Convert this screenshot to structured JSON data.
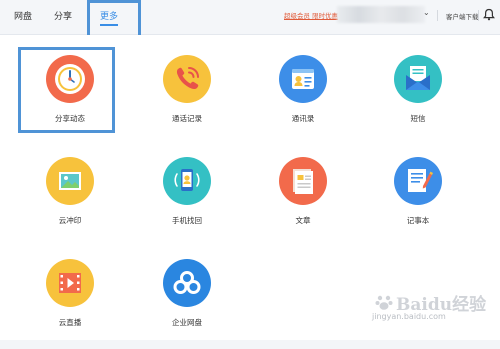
{
  "nav": {
    "tabs": [
      {
        "label": "网盘"
      },
      {
        "label": "分享"
      },
      {
        "label": "更多",
        "active": true
      }
    ]
  },
  "header": {
    "promo_link": "超级会员 限时优惠",
    "client_download": "客户端下载",
    "bell_icon": "bell-icon",
    "user_chevron": "chevron-down-icon"
  },
  "apps": [
    {
      "label": "分享动态",
      "icon": "clock-icon",
      "color": "#f26a4b"
    },
    {
      "label": "通话记录",
      "icon": "phone-icon",
      "color": "#f7c23c"
    },
    {
      "label": "通讯录",
      "icon": "contact-card-icon",
      "color": "#3d8ee8"
    },
    {
      "label": "短信",
      "icon": "envelope-icon",
      "color": "#34c0c4"
    },
    {
      "label": "云冲印",
      "icon": "photo-icon",
      "color": "#f7c23c"
    },
    {
      "label": "手机找回",
      "icon": "phone-find-icon",
      "color": "#34c0c4"
    },
    {
      "label": "文章",
      "icon": "article-icon",
      "color": "#f26a4b"
    },
    {
      "label": "记事本",
      "icon": "notepad-icon",
      "color": "#3d8ee8"
    },
    {
      "label": "云直播",
      "icon": "film-play-icon",
      "color": "#f7c23c"
    },
    {
      "label": "企业网盘",
      "icon": "cloud-icon",
      "color": "#2a86e0"
    }
  ],
  "watermark": {
    "brand": "Baidu经验",
    "url": "jingyan.baidu.com"
  },
  "colors": {
    "accent": "#3a8ee6",
    "highlight_box": "#4f93d6"
  }
}
